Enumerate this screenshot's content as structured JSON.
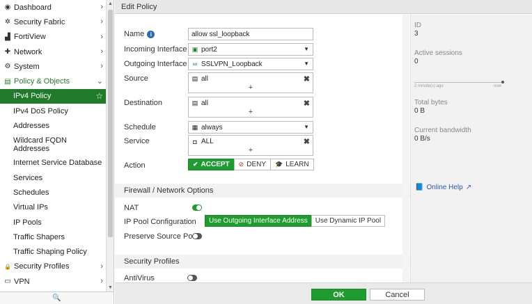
{
  "sidebar": {
    "items": [
      {
        "label": "Dashboard",
        "icon": "dashboard-icon",
        "glyph": "◉",
        "chevron": "›"
      },
      {
        "label": "Security Fabric",
        "icon": "fabric-icon",
        "glyph": "✲",
        "chevron": "›"
      },
      {
        "label": "FortiView",
        "icon": "chart-icon",
        "glyph": "▟",
        "chevron": "›"
      },
      {
        "label": "Network",
        "icon": "network-icon",
        "glyph": "✚",
        "chevron": "›"
      },
      {
        "label": "System",
        "icon": "gear-icon",
        "glyph": "⚙",
        "chevron": "›"
      },
      {
        "label": "Policy & Objects",
        "icon": "policy-icon",
        "glyph": "▤",
        "chevron": "⌄"
      }
    ],
    "sub_items": [
      "IPv4 Policy",
      "IPv4 DoS Policy",
      "Addresses",
      "Wildcard FQDN Addresses",
      "Internet Service Database",
      "Services",
      "Schedules",
      "Virtual IPs",
      "IP Pools",
      "Traffic Shapers",
      "Traffic Shaping Policy"
    ],
    "bottom_items": [
      {
        "label": "Security Profiles",
        "icon": "lock-icon",
        "glyph": "🔒",
        "chevron": "›"
      },
      {
        "label": "VPN",
        "icon": "monitor-icon",
        "glyph": "▭",
        "chevron": "›"
      }
    ],
    "search_glyph": "🔍"
  },
  "header": {
    "title": "Edit Policy"
  },
  "form": {
    "name_label": "Name",
    "name_value": "allow ssl_loopback",
    "incoming_label": "Incoming Interface",
    "incoming_value": "port2",
    "outgoing_label": "Outgoing Interface",
    "outgoing_value": "SSLVPN_Loopback",
    "source_label": "Source",
    "source_value": "all",
    "destination_label": "Destination",
    "destination_value": "all",
    "schedule_label": "Schedule",
    "schedule_value": "always",
    "service_label": "Service",
    "service_value": "ALL",
    "action_label": "Action",
    "actions": [
      "ACCEPT",
      "DENY",
      "LEARN"
    ],
    "action_selected": "ACCEPT",
    "plus": "+",
    "remove": "✖",
    "caret": "▼"
  },
  "firewall": {
    "section_title": "Firewall / Network Options",
    "nat_label": "NAT",
    "nat_enabled": true,
    "ippool_label": "IP Pool Configuration",
    "ippool_options": [
      "Use Outgoing Interface Address",
      "Use Dynamic IP Pool"
    ],
    "ippool_selected": "Use Outgoing Interface Address",
    "preserve_label": "Preserve Source Port",
    "preserve_enabled": false
  },
  "security": {
    "section_title": "Security Profiles",
    "antivirus_label": "AntiVirus",
    "antivirus_enabled": false
  },
  "info_panel": {
    "id_label": "ID",
    "id_value": "3",
    "sessions_label": "Active sessions",
    "sessions_value": "0",
    "spark_start": "2 minute(s) ago",
    "spark_end": "now",
    "bytes_label": "Total bytes",
    "bytes_value": "0 B",
    "bandwidth_label": "Current bandwidth",
    "bandwidth_value": "0 B/s",
    "help_label": "Online Help"
  },
  "footer": {
    "ok_label": "OK",
    "cancel_label": "Cancel"
  },
  "colors": {
    "accent": "#1f9c2e",
    "active_nav": "#1f7a2a",
    "link": "#2a5b9e"
  }
}
